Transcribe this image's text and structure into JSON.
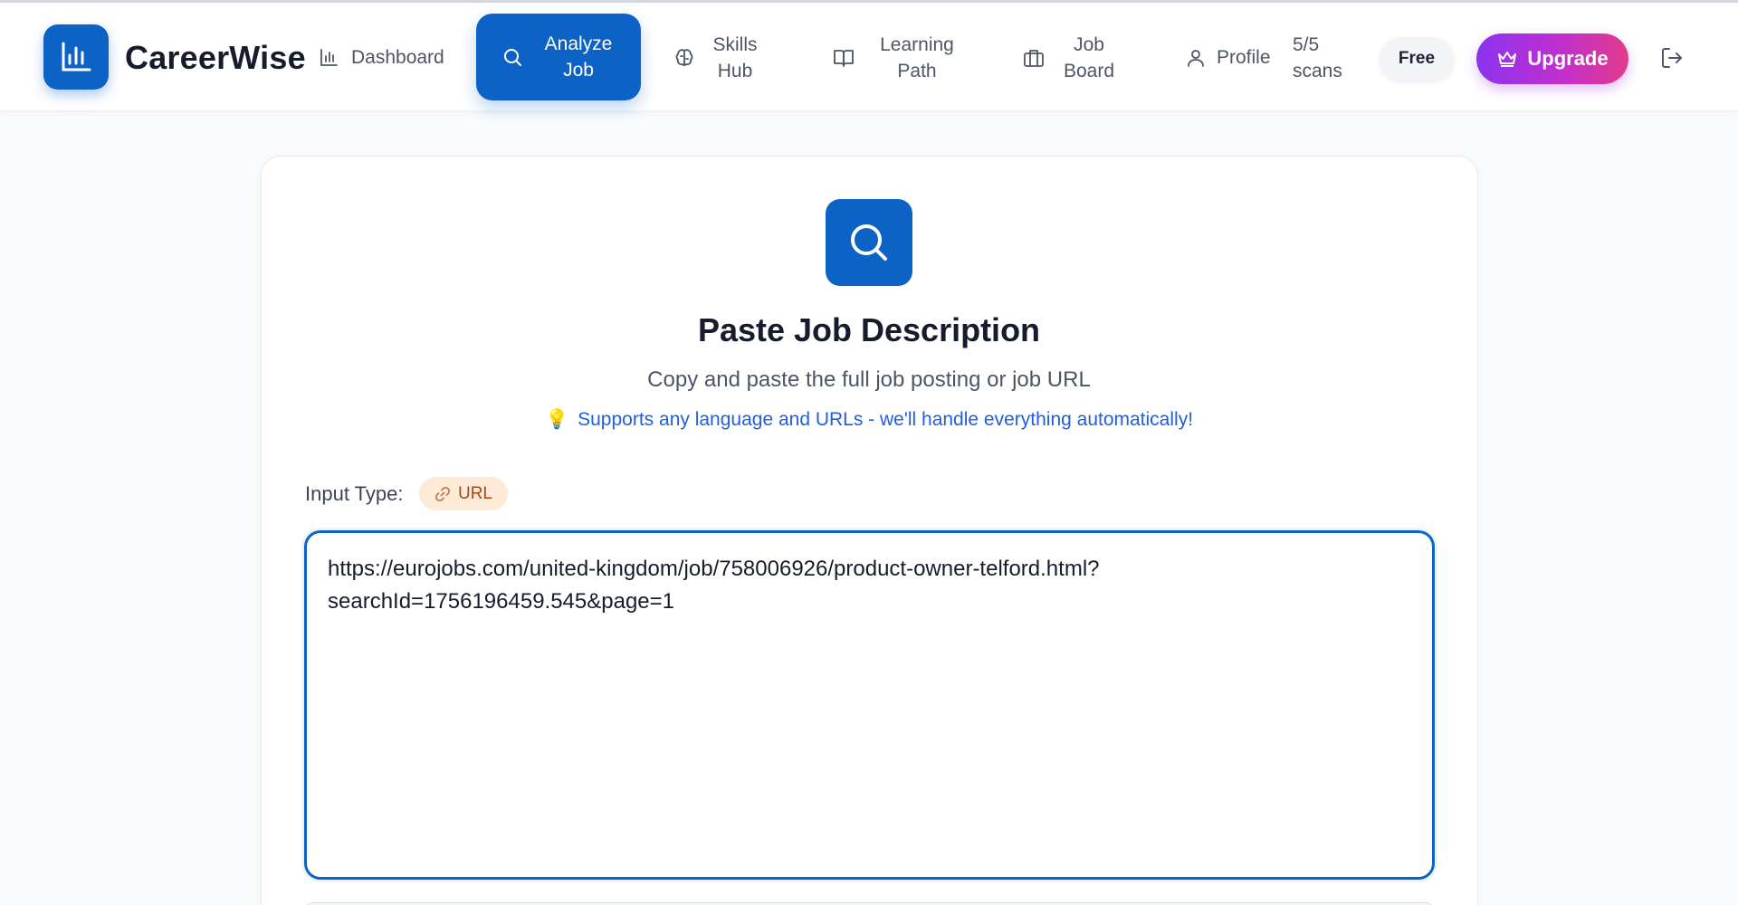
{
  "header": {
    "brand": "CareerWise",
    "nav": {
      "dashboard": "Dashboard",
      "analyze_job": "Analyze Job",
      "skills_hub": "Skills Hub",
      "learning_path": "Learning Path",
      "job_board": "Job Board",
      "profile": "Profile"
    },
    "scans": "5/5 scans",
    "plan_badge": "Free",
    "upgrade_label": "Upgrade"
  },
  "main": {
    "title": "Paste Job Description",
    "subtitle": "Copy and paste the full job posting or job URL",
    "tip": "Supports any language and URLs - we'll handle everything automatically!",
    "input_type_label": "Input Type:",
    "input_type_value": "URL",
    "job_input_value": "https://eurojobs.com/united-kingdom/job/758006926/product-owner-telford.html?searchId=1756196459.545&page=1"
  },
  "icons": {
    "logo": "bar-chart-icon",
    "dashboard": "bar-chart-icon",
    "analyze": "search-icon",
    "skills": "brain-icon",
    "learning": "open-book-icon",
    "jobs": "briefcase-icon",
    "profile": "user-icon",
    "upgrade": "crown-icon",
    "logout": "logout-icon",
    "tip": "lightbulb-icon",
    "url_chip": "link-icon"
  },
  "colors": {
    "primary": "#0d63c5",
    "upgrade_gradient_start": "#8b33f0",
    "upgrade_gradient_end": "#e23a8a",
    "tip_text": "#1f5fe0",
    "url_chip_bg": "#fdebd8",
    "url_chip_text": "#a5481a"
  }
}
